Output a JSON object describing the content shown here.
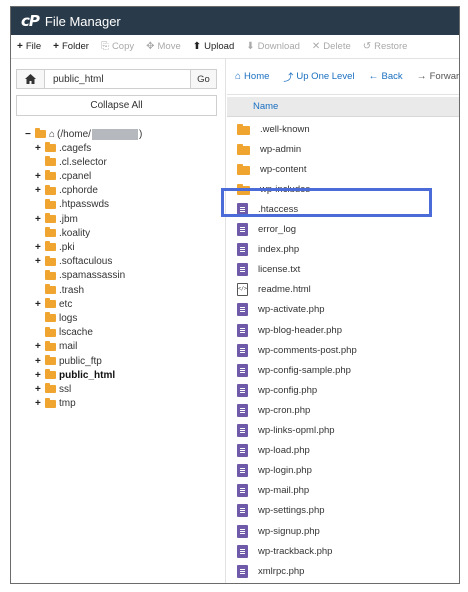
{
  "app": {
    "logo_text": "cP",
    "title": "File Manager"
  },
  "toolbar": {
    "buttons": [
      {
        "icon": "+",
        "label": "File",
        "disabled": false
      },
      {
        "icon": "+",
        "label": "Folder",
        "disabled": false
      },
      {
        "icon": "⎘",
        "label": "Copy",
        "disabled": true
      },
      {
        "icon": "✥",
        "label": "Move",
        "disabled": true
      },
      {
        "icon": "⬆",
        "label": "Upload",
        "disabled": false
      },
      {
        "icon": "⬇",
        "label": "Download",
        "disabled": true
      },
      {
        "icon": "✕",
        "label": "Delete",
        "disabled": true
      },
      {
        "icon": "↺",
        "label": "Restore",
        "disabled": true
      }
    ]
  },
  "left": {
    "path_value": "public_html",
    "go_label": "Go",
    "collapse_label": "Collapse All",
    "tree": {
      "root_prefix": "(/home/",
      "root_suffix": ")",
      "items": [
        {
          "label": ".cagefs",
          "expandable": true
        },
        {
          "label": ".cl.selector",
          "expandable": false
        },
        {
          "label": ".cpanel",
          "expandable": true
        },
        {
          "label": ".cphorde",
          "expandable": true
        },
        {
          "label": ".htpasswds",
          "expandable": false
        },
        {
          "label": ".jbm",
          "expandable": true
        },
        {
          "label": ".koality",
          "expandable": false
        },
        {
          "label": ".pki",
          "expandable": true
        },
        {
          "label": ".softaculous",
          "expandable": true
        },
        {
          "label": ".spamassassin",
          "expandable": false
        },
        {
          "label": ".trash",
          "expandable": false
        },
        {
          "label": "etc",
          "expandable": true
        },
        {
          "label": "logs",
          "expandable": false
        },
        {
          "label": "lscache",
          "expandable": false
        },
        {
          "label": "mail",
          "expandable": true
        },
        {
          "label": "public_ftp",
          "expandable": true
        },
        {
          "label": "public_html",
          "expandable": true,
          "bold": true
        },
        {
          "label": "ssl",
          "expandable": true
        },
        {
          "label": "tmp",
          "expandable": true
        }
      ]
    }
  },
  "right": {
    "nav": [
      {
        "icon": "⌂",
        "label": "Home"
      },
      {
        "icon": "⤴",
        "label": "Up One Level"
      },
      {
        "icon": "←",
        "label": "Back"
      },
      {
        "icon": "→",
        "label": "Forwar"
      }
    ],
    "column_name": "Name",
    "files": [
      {
        "name": ".well-known",
        "type": "folder"
      },
      {
        "name": "wp-admin",
        "type": "folder"
      },
      {
        "name": "wp-content",
        "type": "folder"
      },
      {
        "name": "wp-includes",
        "type": "folder"
      },
      {
        "name": ".htaccess",
        "type": "doc",
        "highlighted": true
      },
      {
        "name": "error_log",
        "type": "doc"
      },
      {
        "name": "index.php",
        "type": "doc"
      },
      {
        "name": "license.txt",
        "type": "doc"
      },
      {
        "name": "readme.html",
        "type": "html"
      },
      {
        "name": "wp-activate.php",
        "type": "doc"
      },
      {
        "name": "wp-blog-header.php",
        "type": "doc"
      },
      {
        "name": "wp-comments-post.php",
        "type": "doc"
      },
      {
        "name": "wp-config-sample.php",
        "type": "doc"
      },
      {
        "name": "wp-config.php",
        "type": "doc"
      },
      {
        "name": "wp-cron.php",
        "type": "doc"
      },
      {
        "name": "wp-links-opml.php",
        "type": "doc"
      },
      {
        "name": "wp-load.php",
        "type": "doc"
      },
      {
        "name": "wp-login.php",
        "type": "doc"
      },
      {
        "name": "wp-mail.php",
        "type": "doc"
      },
      {
        "name": "wp-settings.php",
        "type": "doc"
      },
      {
        "name": "wp-signup.php",
        "type": "doc"
      },
      {
        "name": "wp-trackback.php",
        "type": "doc"
      },
      {
        "name": "xmlrpc.php",
        "type": "doc"
      }
    ]
  },
  "colors": {
    "header_bg": "#293a4a",
    "link": "#1a6fc0",
    "folder": "#f0a530",
    "doc": "#6e5aa8",
    "highlight": "#4a6bd8"
  }
}
